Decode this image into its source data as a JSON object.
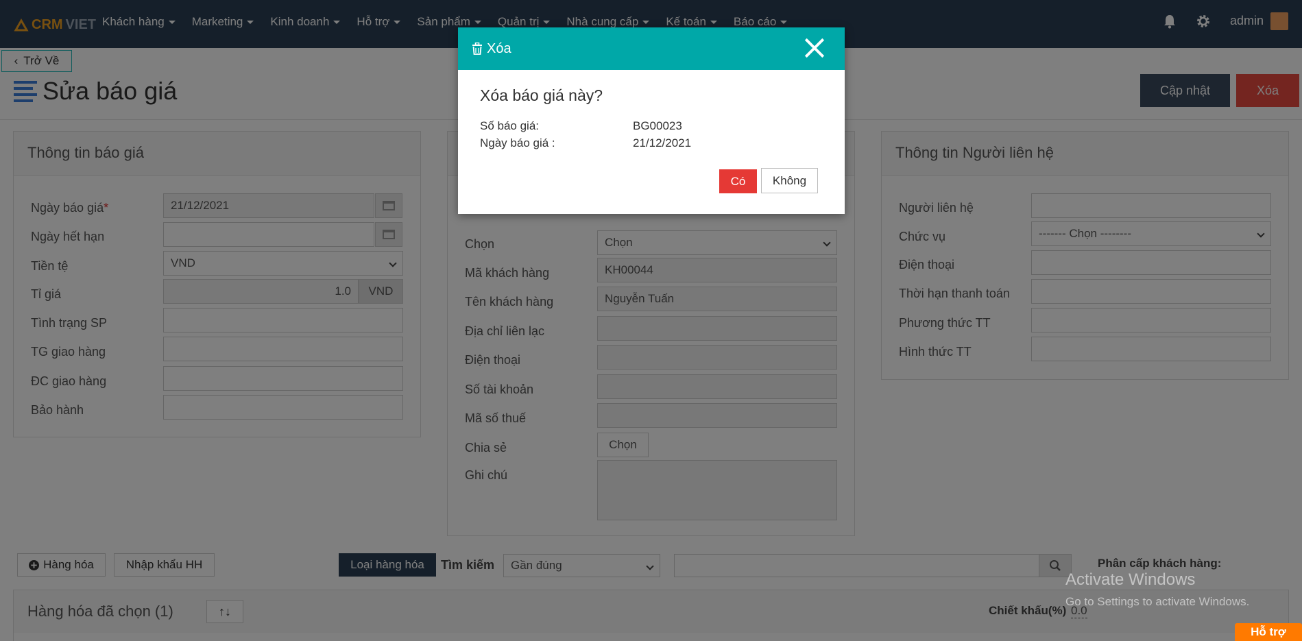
{
  "navbar": {
    "logo_text_1": "CRM",
    "logo_text_2": "VIET",
    "menu": [
      "Khách hàng",
      "Marketing",
      "Kinh doanh",
      "Hỗ trợ",
      "Sản phẩm",
      "Quản trị",
      "Nhà cung cấp",
      "Kế toán",
      "Báo cáo"
    ],
    "user": "admin"
  },
  "back_label": "Trở Về",
  "page_title": "Sửa báo giá",
  "actions": {
    "update": "Cập nhật",
    "delete": "Xóa"
  },
  "quote_panel": {
    "title": "Thông tin báo giá",
    "fields": [
      {
        "label": "Ngày báo giá",
        "value": "21/12/2021",
        "required": "*"
      },
      {
        "label": "Ngày hết hạn",
        "value": ""
      },
      {
        "label": "Tiền tệ",
        "value": "VND"
      },
      {
        "label": "Tỉ giá",
        "value": "1.0",
        "suffix": "VND"
      },
      {
        "label": "Tình trạng SP",
        "value": ""
      },
      {
        "label": "TG giao hàng",
        "value": ""
      },
      {
        "label": "ĐC giao hàng",
        "value": ""
      },
      {
        "label": "Bảo hành",
        "value": ""
      }
    ]
  },
  "customer_panel": {
    "fields": [
      {
        "label": "Chọn",
        "value": "Chọn"
      },
      {
        "label": "Mã khách hàng",
        "value": "KH00044"
      },
      {
        "label": "Tên khách hàng",
        "value": "Nguyễn Tuấn"
      },
      {
        "label": "Địa chỉ liên lạc",
        "value": ""
      },
      {
        "label": "Điện thoại",
        "value": ""
      },
      {
        "label": "Số tài khoản",
        "value": ""
      },
      {
        "label": "Mã số thuế",
        "value": ""
      },
      {
        "label": "Chia sẻ",
        "value": "Chọn"
      },
      {
        "label": "Ghi chú",
        "value": ""
      }
    ]
  },
  "contact_panel": {
    "title": "Thông tin Người liên hệ",
    "fields": [
      {
        "label": "Người liên hệ",
        "value": ""
      },
      {
        "label": "Chức vụ",
        "value": "------- Chọn --------"
      },
      {
        "label": "Điện thoại",
        "value": ""
      },
      {
        "label": "Thời hạn thanh toán",
        "value": ""
      },
      {
        "label": "Phương thức TT",
        "value": ""
      },
      {
        "label": "Hình thức TT",
        "value": ""
      }
    ]
  },
  "goods_toolbar": {
    "add_goods": "Hàng hóa",
    "import_goods": "Nhập khẩu HH",
    "goods_type": "Loại hàng hóa",
    "search_label": "Tìm kiếm",
    "search_mode": "Gần đúng",
    "customer_tier": "Phân cấp khách hàng:"
  },
  "selected_goods": {
    "title": "Hàng hóa đã chọn (1)",
    "discount_label": "Chiết khấu(%)",
    "discount_value": "0.0"
  },
  "modal": {
    "title": "Xóa",
    "question": "Xóa báo giá này?",
    "rows": [
      {
        "label": "Số báo giá:",
        "value": "BG00023"
      },
      {
        "label": "Ngày báo giá :",
        "value": "21/12/2021"
      }
    ],
    "yes": "Có",
    "no": "Không"
  },
  "watermark": {
    "line1": "Activate Windows",
    "line2": "Go to Settings to activate Windows."
  },
  "support": "Hỗ trợ"
}
